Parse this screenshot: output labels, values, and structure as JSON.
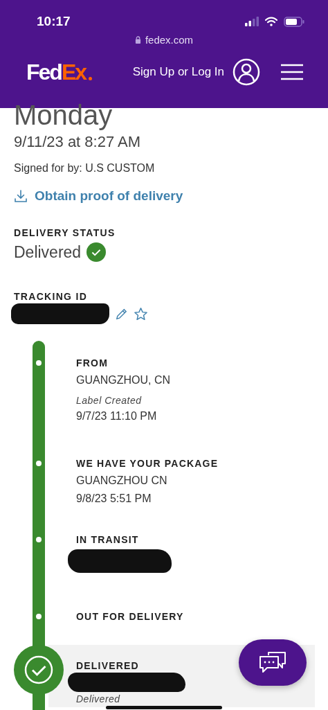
{
  "status_bar": {
    "time": "10:17"
  },
  "browser": {
    "url": "fedex.com"
  },
  "header": {
    "logo": {
      "text": "Fed",
      "accent": "Ex"
    },
    "sign_in": "Sign Up or Log In"
  },
  "delivery": {
    "day": "Monday",
    "datetime": "9/11/23 at 8:27 AM",
    "signed_for": "Signed for by: U.S CUSTOM",
    "proof_link": "Obtain proof of delivery"
  },
  "status": {
    "label": "DELIVERY STATUS",
    "value": "Delivered",
    "delivered": true
  },
  "tracking": {
    "label": "TRACKING ID",
    "redacted": true
  },
  "events": [
    {
      "kind": "step",
      "title": "FROM",
      "redacted": false,
      "lines": [
        {
          "kind": "detail",
          "text": "GUANGZHOU, CN"
        },
        {
          "kind": "note",
          "text": "Label Created"
        },
        {
          "kind": "detail",
          "text": "9/7/23 11:10 PM"
        }
      ]
    },
    {
      "kind": "step",
      "title": "WE HAVE YOUR PACKAGE",
      "redacted": false,
      "lines": [
        {
          "kind": "detail",
          "text": "GUANGZHOU CN"
        },
        {
          "kind": "detail",
          "text": "9/8/23 5:51 PM"
        }
      ]
    },
    {
      "kind": "step",
      "title": "IN TRANSIT",
      "redacted": true
    },
    {
      "kind": "step",
      "title": "OUT FOR DELIVERY",
      "redacted": false
    },
    {
      "kind": "final",
      "title": "DELIVERED",
      "redacted": true,
      "lines": [
        {
          "kind": "note",
          "text": "Delivered"
        }
      ]
    }
  ]
}
